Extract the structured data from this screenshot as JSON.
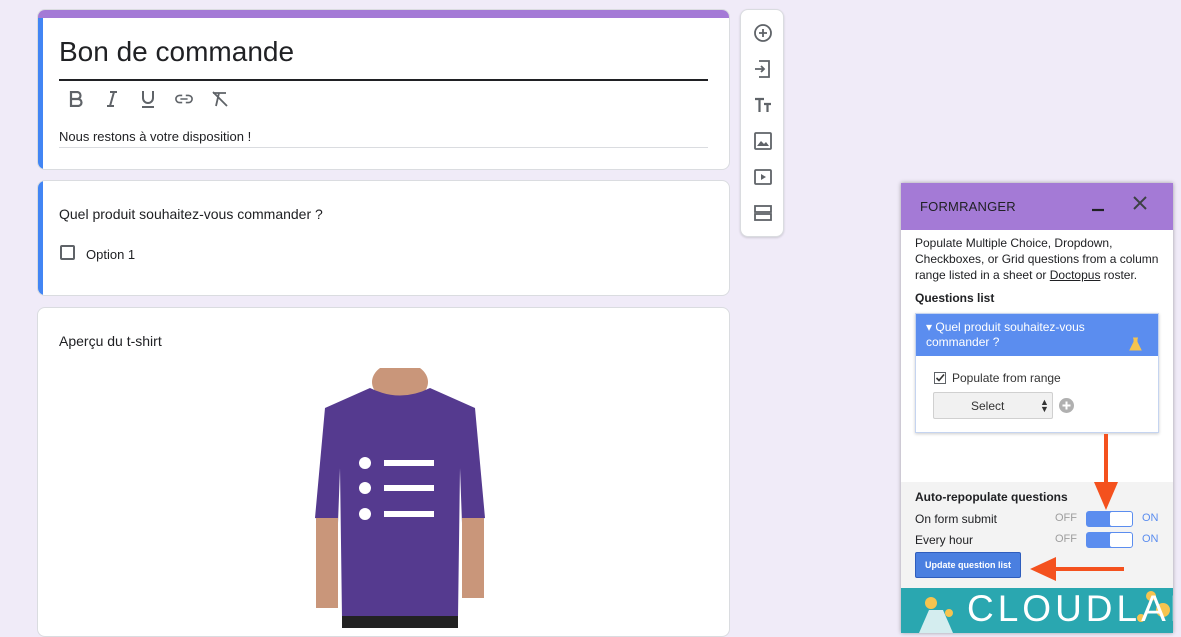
{
  "form": {
    "title": "Bon de commande",
    "description": "Nous restons à votre disposition !",
    "format_toolbar": [
      "bold-icon",
      "italic-icon",
      "underline-icon",
      "link-icon",
      "clear-format-icon"
    ],
    "accent_color": "#a47ad6",
    "focus_color": "#4285f4"
  },
  "question": {
    "text": "Quel produit souhaitez-vous commander ?",
    "option1": "Option 1"
  },
  "image_item": {
    "title": "Aperçu du t-shirt"
  },
  "side_toolbar": [
    "add-question-icon",
    "import-questions-icon",
    "add-title-icon",
    "add-image-icon",
    "add-video-icon",
    "add-section-icon"
  ],
  "panel": {
    "title": "FORMRANGER",
    "desc_part1": "Populate Multiple Choice, Dropdown, Checkboxes, or Grid questions from a column range listed in a sheet or ",
    "desc_link": "Doctopus",
    "desc_part2": " roster.",
    "questions_heading": "Questions list",
    "question_item": "▾ Quel produit souhaitez-vous commander ?",
    "populate_label": "Populate from range",
    "populate_checked": true,
    "select_label": "Select",
    "auto_heading": "Auto-repopulate questions",
    "rows": [
      {
        "label": "On form submit",
        "off": "OFF",
        "on": "ON",
        "state": "on"
      },
      {
        "label": "Every hour",
        "off": "OFF",
        "on": "ON",
        "state": "on"
      }
    ],
    "update_button": "Update question list",
    "banner_text": "CLOUDLAB",
    "header_color": "#a47ad6",
    "toggle_color": "#5b8def",
    "arrow_color": "#f4511e",
    "banner_color": "#2aa7b0"
  }
}
